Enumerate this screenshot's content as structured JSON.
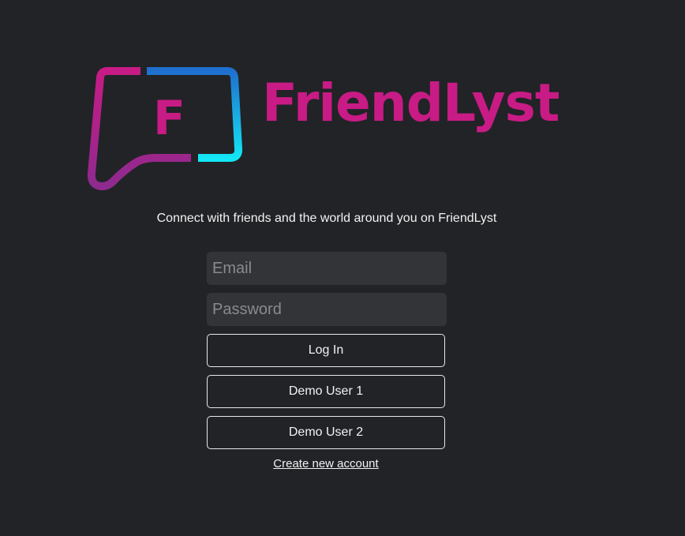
{
  "brand": {
    "logo_letter": "F",
    "name": "FriendLyst",
    "colors": {
      "magenta": "#c81b85",
      "purple": "#8e2a8f",
      "blue": "#1e6fd6",
      "cyan": "#13e6f5"
    }
  },
  "tagline": "Connect with friends and the world around you on FriendLyst",
  "login_form": {
    "email_placeholder": "Email",
    "password_placeholder": "Password",
    "login_label": "Log In",
    "demo1_label": "Demo User 1",
    "demo2_label": "Demo User 2",
    "create_account_label": "Create new account"
  }
}
